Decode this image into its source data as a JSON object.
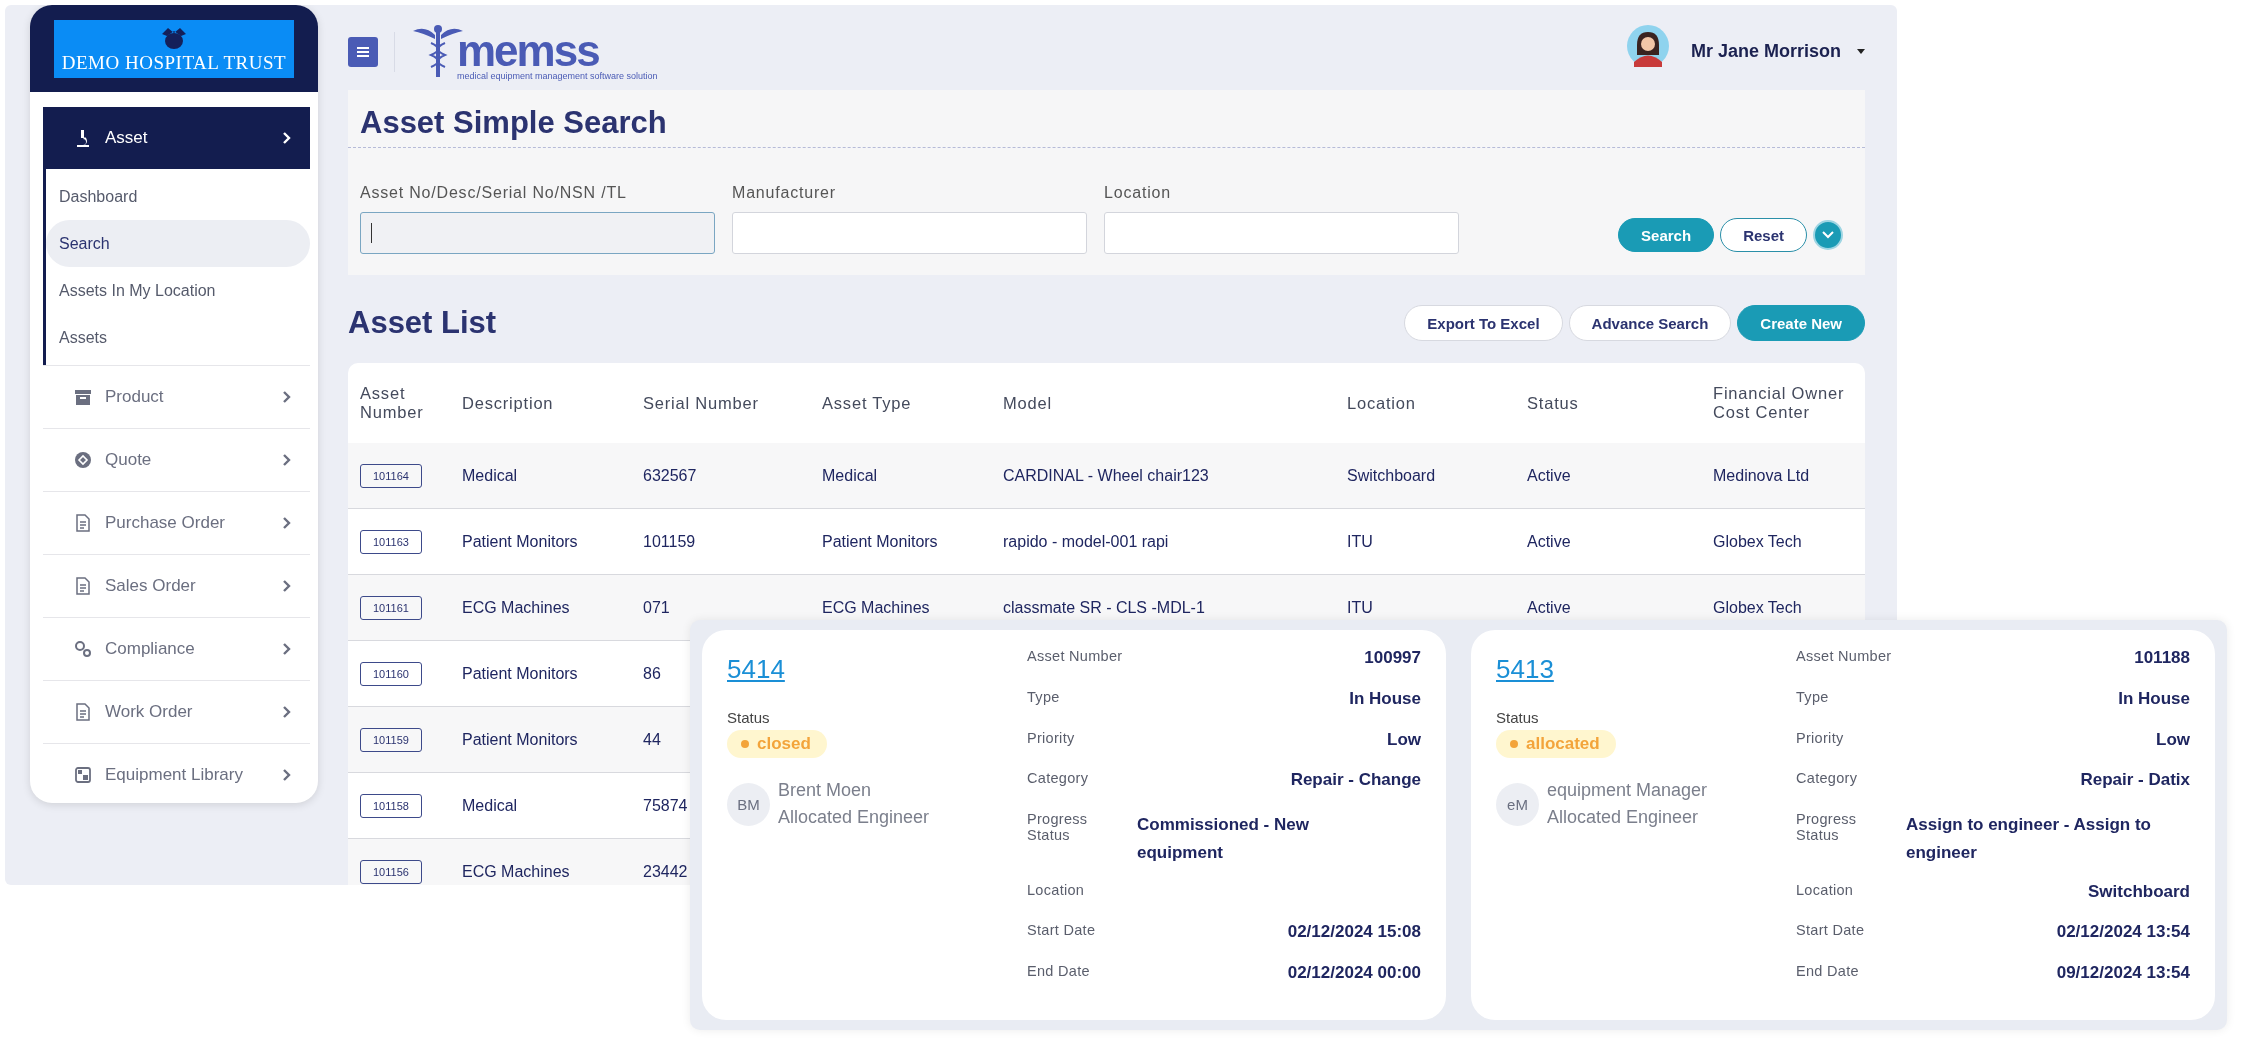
{
  "sidebar": {
    "brand": "DEMO HOSPITAL TRUST",
    "items": [
      {
        "label": "Asset",
        "selected": true,
        "expanded": true,
        "children": [
          {
            "label": "Dashboard",
            "selected": false
          },
          {
            "label": "Search",
            "selected": true
          },
          {
            "label": "Assets In My Location",
            "selected": false
          },
          {
            "label": "Assets",
            "selected": false
          }
        ]
      },
      {
        "label": "Product",
        "selected": false
      },
      {
        "label": "Quote",
        "selected": false
      },
      {
        "label": "Purchase Order",
        "selected": false
      },
      {
        "label": "Sales Order",
        "selected": false
      },
      {
        "label": "Compliance",
        "selected": false
      },
      {
        "label": "Work Order",
        "selected": false
      },
      {
        "label": "Equipment Library",
        "selected": false
      }
    ]
  },
  "header": {
    "logo_text": "memss",
    "logo_tagline": "medical equipment management software solution",
    "user_name": "Mr Jane Morrison"
  },
  "search_panel": {
    "title": "Asset Simple Search",
    "fields": [
      {
        "label": "Asset No/Desc/Serial No/NSN /TL",
        "focused": true
      },
      {
        "label": "Manufacturer",
        "focused": false
      },
      {
        "label": "Location",
        "focused": false
      }
    ],
    "buttons": [
      {
        "label": "Search",
        "kind": "primary"
      },
      {
        "label": "Reset",
        "kind": "outline"
      }
    ]
  },
  "asset_list": {
    "title": "Asset List",
    "buttons": [
      {
        "label": "Export To Excel",
        "kind": "outline"
      },
      {
        "label": "Advance Search",
        "kind": "outline"
      },
      {
        "label": "Create New",
        "kind": "primary"
      }
    ],
    "columns": [
      "Asset Number",
      "Description",
      "Serial Number",
      "Asset Type",
      "Model",
      "Location",
      "Status",
      "Financial Owner Cost Center"
    ],
    "rows": [
      {
        "cells": [
          "101164",
          "Medical",
          "632567",
          "Medical",
          "CARDINAL - Wheel chair123",
          "Switchboard",
          "Active",
          "Medinova Ltd"
        ]
      },
      {
        "cells": [
          "101163",
          "Patient Monitors",
          "101159",
          "Patient Monitors",
          "rapido - model-001 rapi",
          "ITU",
          "Active",
          "Globex Tech"
        ]
      },
      {
        "cells": [
          "101161",
          "ECG Machines",
          "071",
          "ECG Machines",
          "classmate SR - CLS -MDL-1",
          "ITU",
          "Active",
          "Globex Tech"
        ]
      },
      {
        "cells": [
          "101160",
          "Patient Monitors",
          "86"
        ]
      },
      {
        "cells": [
          "101159",
          "Patient Monitors",
          "44"
        ]
      },
      {
        "cells": [
          "101158",
          "Medical",
          "75874"
        ]
      },
      {
        "cells": [
          "101156",
          "ECG Machines",
          "23442"
        ]
      }
    ]
  },
  "work_orders": [
    {
      "id": "5414",
      "status_label": "Status",
      "status": "closed",
      "initials": "BM",
      "engineer": "Brent Moen",
      "role": "Allocated Engineer",
      "details": [
        {
          "label": "Asset Number",
          "value": "100997"
        },
        {
          "label": "Type",
          "value": "In House"
        },
        {
          "label": "Priority",
          "value": "Low"
        },
        {
          "label": "Category",
          "value": "Repair - Change"
        },
        {
          "label": "Progress Status",
          "value": "Commissioned - New equipment",
          "kind": "long"
        },
        {
          "label": "Location"
        },
        {
          "label": "Start Date",
          "value": "02/12/2024 15:08"
        },
        {
          "label": "End Date",
          "value": "02/12/2024 00:00"
        }
      ]
    },
    {
      "id": "5413",
      "status_label": "Status",
      "status": "allocated",
      "initials": "eM",
      "engineer": "equipment Manager",
      "role": "Allocated Engineer",
      "details": [
        {
          "label": "Asset Number",
          "value": "101188"
        },
        {
          "label": "Type",
          "value": "In House"
        },
        {
          "label": "Priority",
          "value": "Low"
        },
        {
          "label": "Category",
          "value": "Repair - Datix"
        },
        {
          "label": "Progress Status",
          "value": "Assign to engineer - Assign to engineer",
          "kind": "long"
        },
        {
          "label": "Location",
          "value": "Switchboard"
        },
        {
          "label": "Start Date",
          "value": "02/12/2024 13:54"
        },
        {
          "label": "End Date",
          "value": "09/12/2024 13:54"
        }
      ]
    }
  ]
}
